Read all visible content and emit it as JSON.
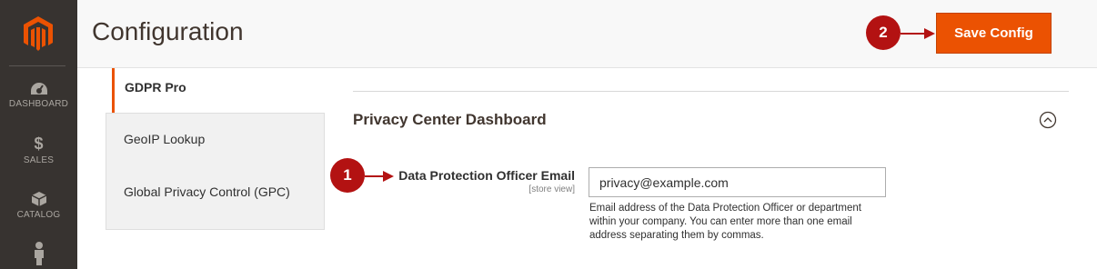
{
  "nav": {
    "items": [
      {
        "label": "DASHBOARD",
        "icon": "dashboard-icon"
      },
      {
        "label": "SALES",
        "icon": "dollar-icon"
      },
      {
        "label": "CATALOG",
        "icon": "box-icon"
      },
      {
        "label": "",
        "icon": "customer-icon"
      }
    ]
  },
  "header": {
    "title": "Configuration",
    "save_label": "Save Config",
    "badge": "2"
  },
  "tabs": {
    "active": "GDPR Pro",
    "items": [
      "GeoIP Lookup",
      "Global Privacy Control (GPC)"
    ]
  },
  "section": {
    "title": "Privacy Center Dashboard"
  },
  "field": {
    "badge": "1",
    "label": "Data Protection Officer Email",
    "scope": "[store view]",
    "value": "privacy@example.com",
    "note": "Email address of the Data Protection Officer or department within your company. You can enter more than one email address separating them by commas."
  },
  "colors": {
    "brand": "#eb5202",
    "badge": "#b31212",
    "nav_bg": "#373330"
  }
}
